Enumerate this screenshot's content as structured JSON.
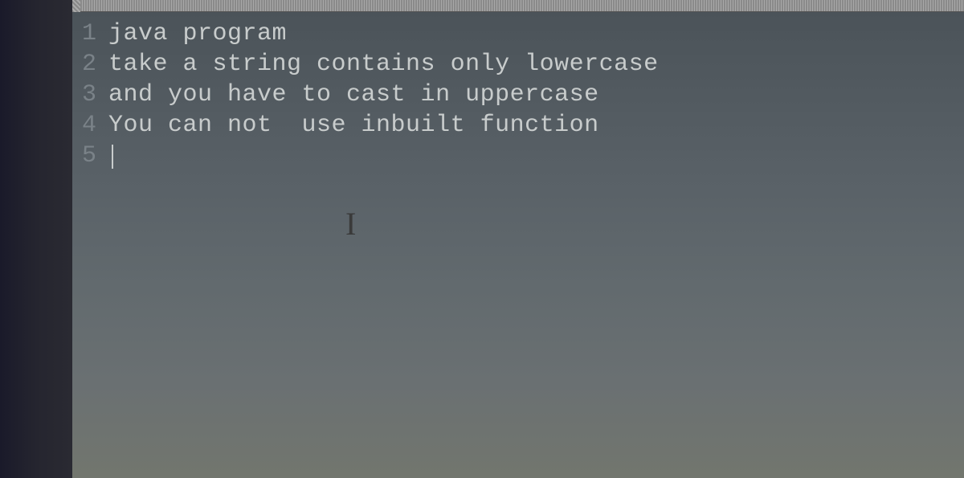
{
  "editor": {
    "lines": [
      {
        "number": "1",
        "content": "java program"
      },
      {
        "number": "2",
        "content": "take a string contains only lowercase"
      },
      {
        "number": "3",
        "content": "and you have to cast in uppercase"
      },
      {
        "number": "4",
        "content": "You can not  use inbuilt function"
      },
      {
        "number": "5",
        "content": ""
      }
    ],
    "cursor_line": 5
  },
  "mouse_cursor_glyph": "I"
}
